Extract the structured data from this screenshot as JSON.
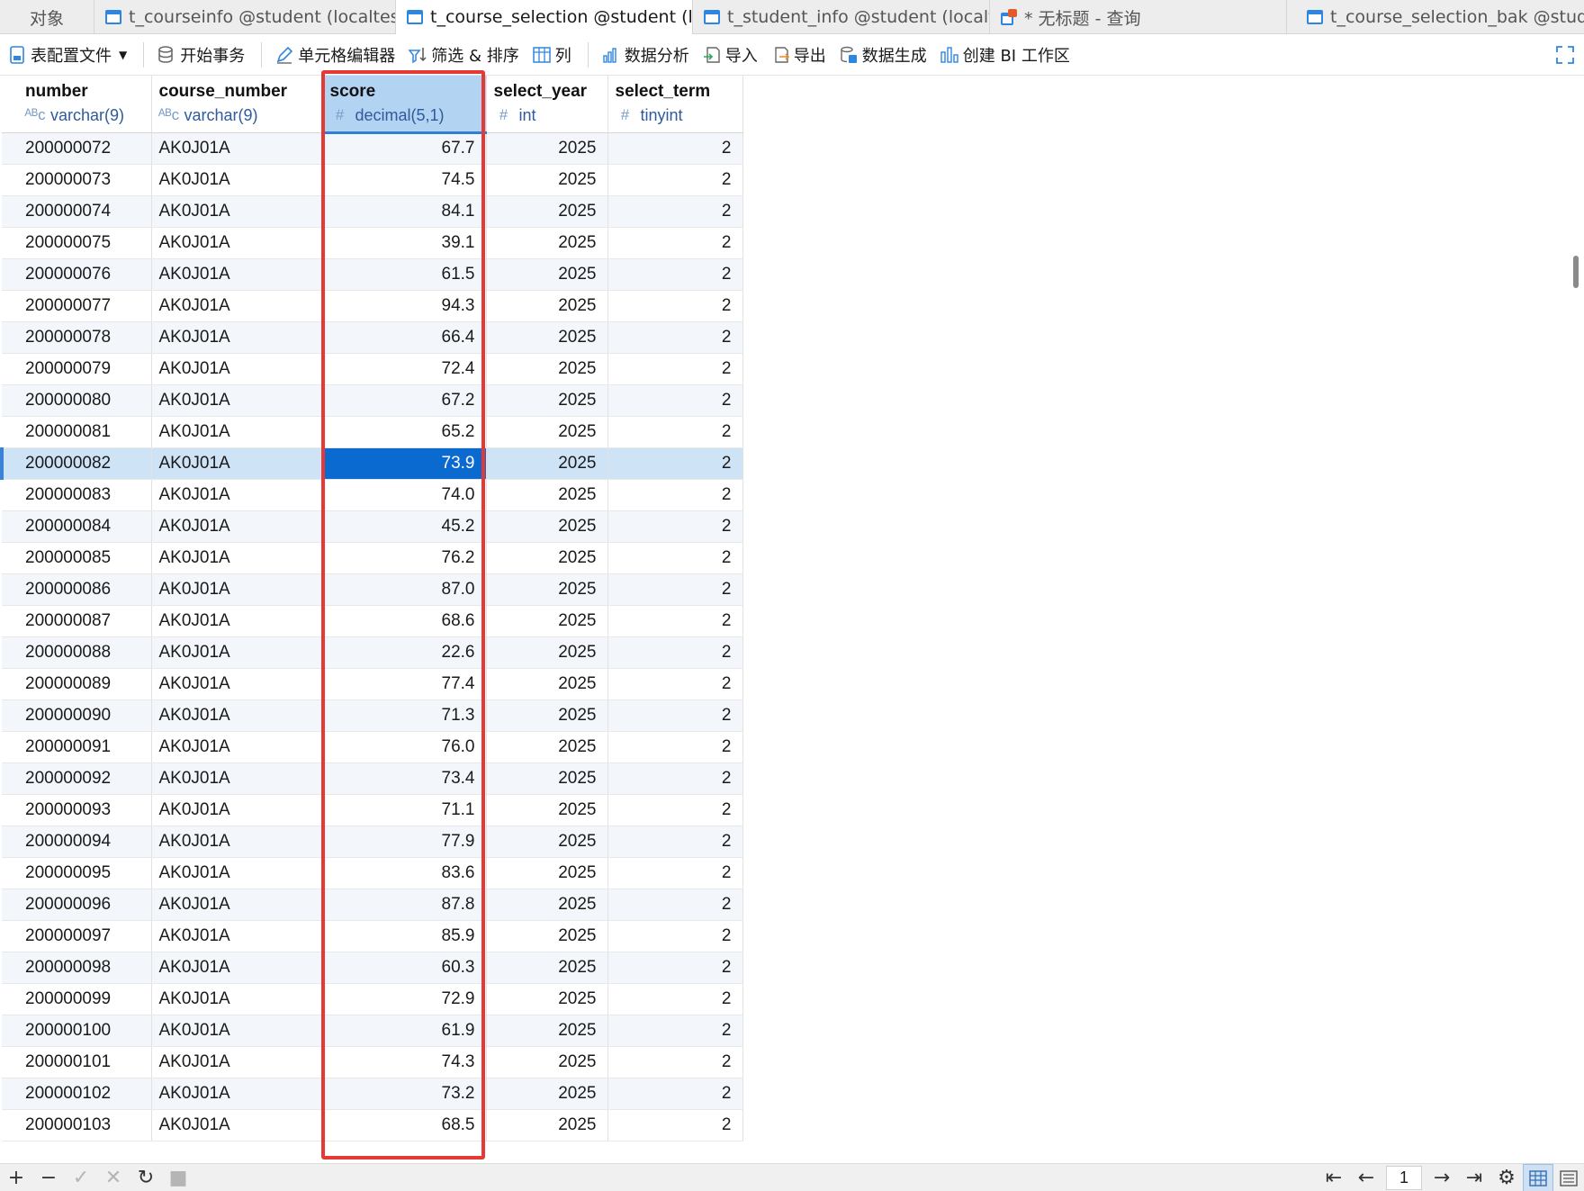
{
  "tabs": {
    "objects": "对象",
    "items": [
      {
        "label": "t_courseinfo @student (localtest...",
        "icon": "table-icon"
      },
      {
        "label": "t_course_selection @student (lo...",
        "icon": "table-icon",
        "active": true
      },
      {
        "label": "t_student_info @student (localt...",
        "icon": "table-icon"
      },
      {
        "label": "* 无标题 - 查询",
        "icon": "query-icon"
      },
      {
        "label": "t_course_selection_bak @stude...",
        "icon": "table-icon"
      }
    ]
  },
  "toolbar": {
    "profile": "表配置文件",
    "begin_tx": "开始事务",
    "cell_editor": "单元格编辑器",
    "filter_sort": "筛选 & 排序",
    "columns": "列",
    "analysis": "数据分析",
    "import": "导入",
    "export": "导出",
    "generate": "数据生成",
    "bi": "创建 BI 工作区"
  },
  "columns": [
    {
      "name": "number",
      "type": "varchar(9)",
      "type_icon": "abc-icon"
    },
    {
      "name": "course_number",
      "type": "varchar(9)",
      "type_icon": "abc-icon"
    },
    {
      "name": "score",
      "type": "decimal(5,1)",
      "type_icon": "hash-icon"
    },
    {
      "name": "select_year",
      "type": "int",
      "type_icon": "hash-icon"
    },
    {
      "name": "select_term",
      "type": "tinyint",
      "type_icon": "hash-icon"
    }
  ],
  "rows": [
    [
      "200000072",
      "AK0J01A",
      "67.7",
      "2025",
      "2"
    ],
    [
      "200000073",
      "AK0J01A",
      "74.5",
      "2025",
      "2"
    ],
    [
      "200000074",
      "AK0J01A",
      "84.1",
      "2025",
      "2"
    ],
    [
      "200000075",
      "AK0J01A",
      "39.1",
      "2025",
      "2"
    ],
    [
      "200000076",
      "AK0J01A",
      "61.5",
      "2025",
      "2"
    ],
    [
      "200000077",
      "AK0J01A",
      "94.3",
      "2025",
      "2"
    ],
    [
      "200000078",
      "AK0J01A",
      "66.4",
      "2025",
      "2"
    ],
    [
      "200000079",
      "AK0J01A",
      "72.4",
      "2025",
      "2"
    ],
    [
      "200000080",
      "AK0J01A",
      "67.2",
      "2025",
      "2"
    ],
    [
      "200000081",
      "AK0J01A",
      "65.2",
      "2025",
      "2"
    ],
    [
      "200000082",
      "AK0J01A",
      "73.9",
      "2025",
      "2"
    ],
    [
      "200000083",
      "AK0J01A",
      "74.0",
      "2025",
      "2"
    ],
    [
      "200000084",
      "AK0J01A",
      "45.2",
      "2025",
      "2"
    ],
    [
      "200000085",
      "AK0J01A",
      "76.2",
      "2025",
      "2"
    ],
    [
      "200000086",
      "AK0J01A",
      "87.0",
      "2025",
      "2"
    ],
    [
      "200000087",
      "AK0J01A",
      "68.6",
      "2025",
      "2"
    ],
    [
      "200000088",
      "AK0J01A",
      "22.6",
      "2025",
      "2"
    ],
    [
      "200000089",
      "AK0J01A",
      "77.4",
      "2025",
      "2"
    ],
    [
      "200000090",
      "AK0J01A",
      "71.3",
      "2025",
      "2"
    ],
    [
      "200000091",
      "AK0J01A",
      "76.0",
      "2025",
      "2"
    ],
    [
      "200000092",
      "AK0J01A",
      "73.4",
      "2025",
      "2"
    ],
    [
      "200000093",
      "AK0J01A",
      "71.1",
      "2025",
      "2"
    ],
    [
      "200000094",
      "AK0J01A",
      "77.9",
      "2025",
      "2"
    ],
    [
      "200000095",
      "AK0J01A",
      "83.6",
      "2025",
      "2"
    ],
    [
      "200000096",
      "AK0J01A",
      "87.8",
      "2025",
      "2"
    ],
    [
      "200000097",
      "AK0J01A",
      "85.9",
      "2025",
      "2"
    ],
    [
      "200000098",
      "AK0J01A",
      "60.3",
      "2025",
      "2"
    ],
    [
      "200000099",
      "AK0J01A",
      "72.9",
      "2025",
      "2"
    ],
    [
      "200000100",
      "AK0J01A",
      "61.9",
      "2025",
      "2"
    ],
    [
      "200000101",
      "AK0J01A",
      "74.3",
      "2025",
      "2"
    ],
    [
      "200000102",
      "AK0J01A",
      "73.2",
      "2025",
      "2"
    ],
    [
      "200000103",
      "AK0J01A",
      "68.5",
      "2025",
      "2"
    ]
  ],
  "selection": {
    "row_index": 10,
    "column": "score"
  },
  "pagination": {
    "page": "1"
  },
  "colors": {
    "accent": "#0a6ad0",
    "highlight_box": "#e53935",
    "selected_header": "#b3d3f2"
  }
}
